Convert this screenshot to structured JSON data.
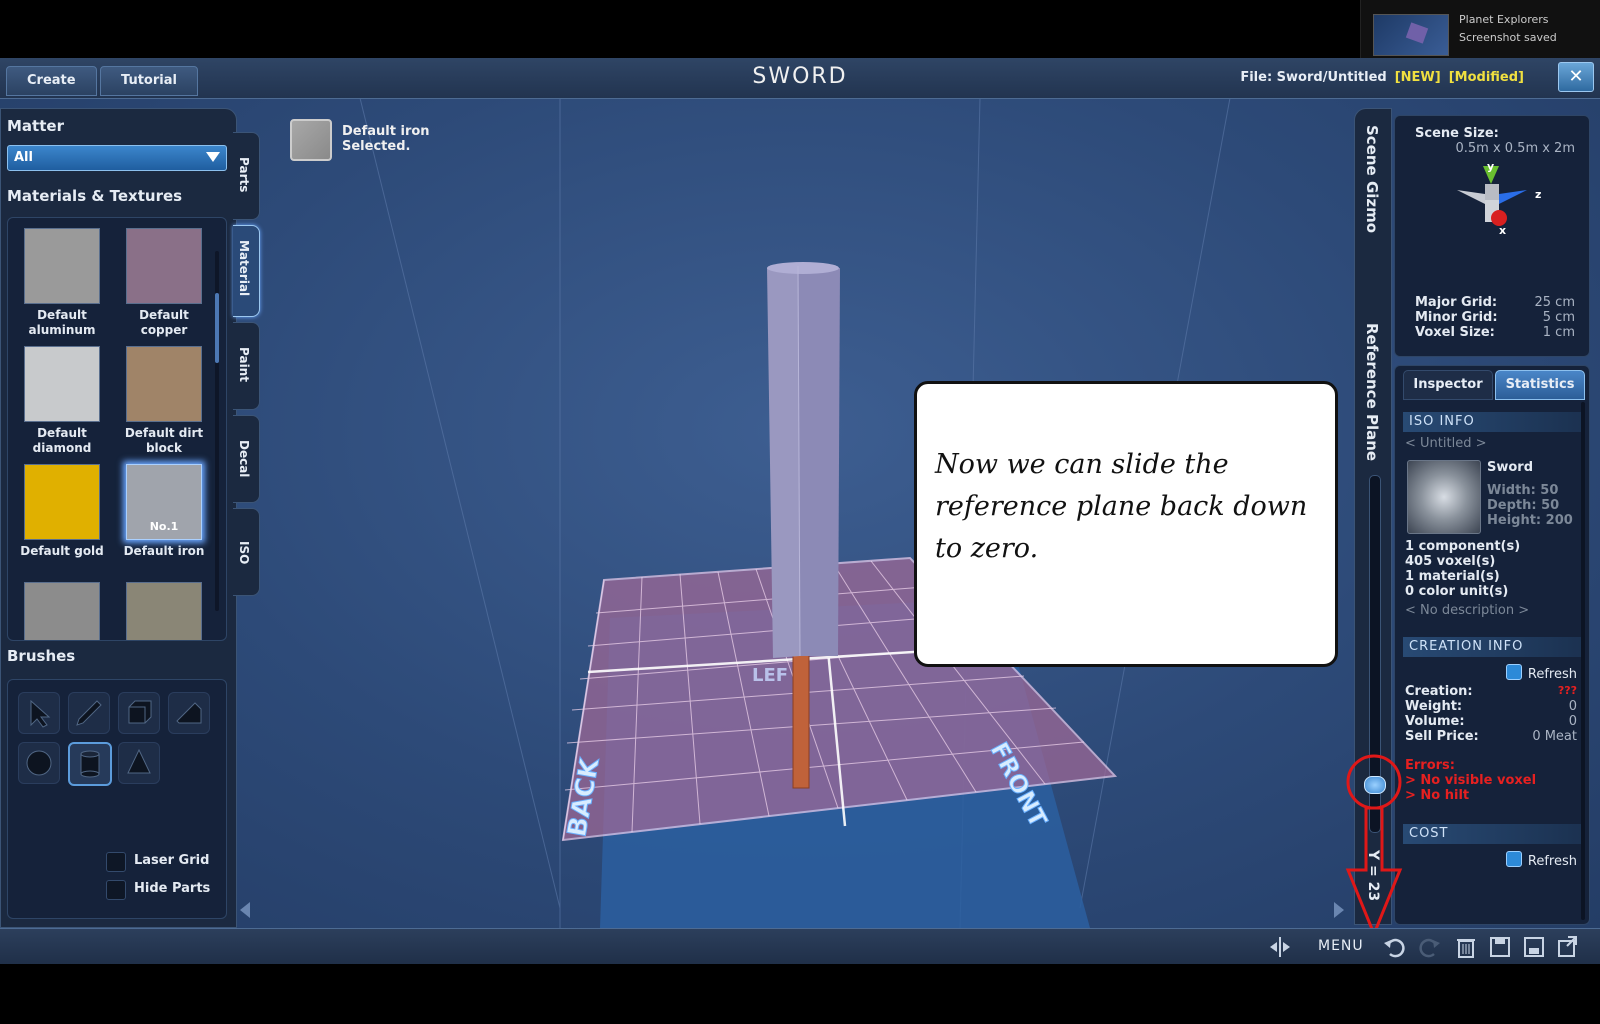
{
  "notification": {
    "app": "Planet Explorers",
    "message": "Screenshot saved"
  },
  "header": {
    "tabs": [
      "Create",
      "Tutorial"
    ],
    "title": "SWORD",
    "file_label": "File:  Sword/Untitled",
    "new_tag": "[NEW]",
    "modified_tag": "[Modified]",
    "close_glyph": "✕"
  },
  "left_panel": {
    "matter_heading": "Matter",
    "matter_value": "All",
    "materials_heading": "Materials & Textures",
    "materials": [
      {
        "label": "Default aluminum",
        "color": "#9a9a9a"
      },
      {
        "label": "Default copper",
        "color": "#8a7088"
      },
      {
        "label": "Default diamond",
        "color": "#c8cacc"
      },
      {
        "label": "Default dirt block",
        "color": "#a08468"
      },
      {
        "label": "Default gold",
        "color": "#e0b000"
      },
      {
        "label": "Default iron",
        "color": "#a0a4ac",
        "badge": "No.1",
        "selected": true
      },
      {
        "label": "",
        "color": "#8c8c8c"
      },
      {
        "label": "",
        "color": "#8a8676"
      }
    ],
    "brushes_heading": "Brushes",
    "brushes": [
      "select-arrow-icon",
      "pencil-icon",
      "box-icon",
      "wedge-icon",
      "sphere-icon",
      "cylinder-icon",
      "cone-icon"
    ],
    "selected_brush": "cylinder-icon",
    "laser_grid_label": "Laser Grid",
    "hide_parts_label": "Hide Parts"
  },
  "side_tabs": [
    {
      "label": "Parts",
      "selected": false
    },
    {
      "label": "Material",
      "selected": true
    },
    {
      "label": "Paint",
      "selected": false
    },
    {
      "label": "Decal",
      "selected": false
    },
    {
      "label": "ISO",
      "selected": false
    }
  ],
  "selection": {
    "line1": "Default iron",
    "line2": "Selected."
  },
  "viewport_labels": {
    "back": "BACK",
    "front": "FRONT",
    "left": "LEF"
  },
  "callout": {
    "text": "Now we can slide the reference plane back down to zero."
  },
  "right_panel": {
    "scene_gizmo_label": "Scene Gizmo",
    "reference_plane_label": "Reference Plane",
    "y_readout": "Y = 23",
    "scene_size_label": "Scene Size:",
    "scene_size_value": "0.5m x 0.5m x 2m",
    "axis_y": "y",
    "axis_z": "z",
    "axis_x": "x",
    "major_grid_label": "Major Grid:",
    "major_grid_value": "25 cm",
    "minor_grid_label": "Minor Grid:",
    "minor_grid_value": "5 cm",
    "voxel_size_label": "Voxel Size:",
    "voxel_size_value": "1 cm",
    "tabs": [
      "Inspector",
      "Statistics"
    ],
    "iso_info_header": "ISO INFO",
    "iso_untitled": "< Untitled >",
    "iso_name": "Sword",
    "iso_width": "Width: 50",
    "iso_depth": "Depth: 50",
    "iso_height": "Height: 200",
    "components": "1 component(s)",
    "voxels": "405 voxel(s)",
    "materials": "1 material(s)",
    "color_units": "0 color unit(s)",
    "no_description": "< No description >",
    "creation_info_header": "CREATION INFO",
    "refresh_label": "Refresh",
    "creation_label": "Creation:",
    "creation_value": "???",
    "weight_label": "Weight:",
    "weight_value": "0",
    "volume_label": "Volume:",
    "volume_value": "0",
    "sell_price_label": "Sell Price:",
    "sell_price_value": "0 Meat",
    "errors_label": "Errors:",
    "error_1": "> No visible voxel",
    "error_2": "> No hilt",
    "cost_header": "COST"
  },
  "bottom_bar": {
    "menu_label": "MENU",
    "icons": [
      "mirror-icon",
      "undo-icon",
      "redo-icon",
      "delete-icon",
      "save-icon",
      "save-as-icon",
      "export-icon"
    ]
  },
  "colors": {
    "accent": "#3a86d0",
    "error": "#e62020",
    "tag_yellow": "#f0e040",
    "annotation_red": "#e01818"
  }
}
